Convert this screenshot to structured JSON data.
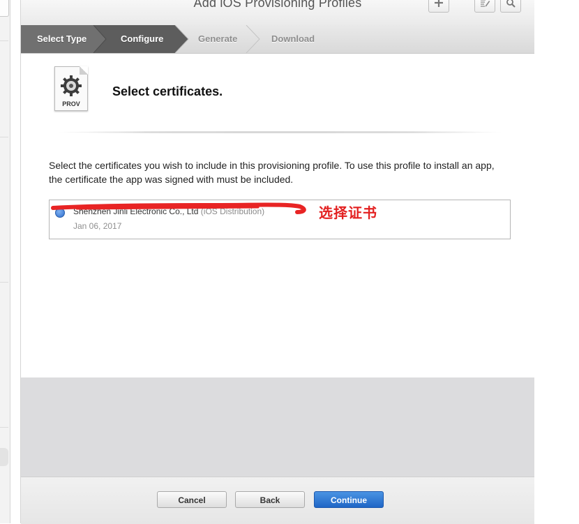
{
  "window": {
    "title": "Add iOS Provisioning Profiles",
    "toolbar_icons": [
      "plus-icon",
      "edit-icon",
      "search-icon"
    ]
  },
  "steps": [
    {
      "label": "Select Type",
      "state": "done"
    },
    {
      "label": "Configure",
      "state": "current"
    },
    {
      "label": "Generate",
      "state": "pending"
    },
    {
      "label": "Download",
      "state": "pending"
    }
  ],
  "header": {
    "icon_label": "PROV",
    "heading": "Select certificates."
  },
  "description": "Select the certificates you wish to include in this provisioning profile. To use this profile to install an app, the certificate the app was signed with must be included.",
  "certificates": [
    {
      "name": "Shenzhen Jinli Electronic Co., Ltd",
      "type": "(iOS Distribution)",
      "date": "Jan 06, 2017",
      "selected": true
    }
  ],
  "annotation": {
    "text": "选择证书",
    "color": "#e32020"
  },
  "footer": {
    "cancel_label": "Cancel",
    "back_label": "Back",
    "continue_label": "Continue"
  },
  "colors": {
    "accent_blue": "#1f66c6",
    "step_active_bg": "#6b6b6b",
    "annotation_red": "#e32020"
  }
}
